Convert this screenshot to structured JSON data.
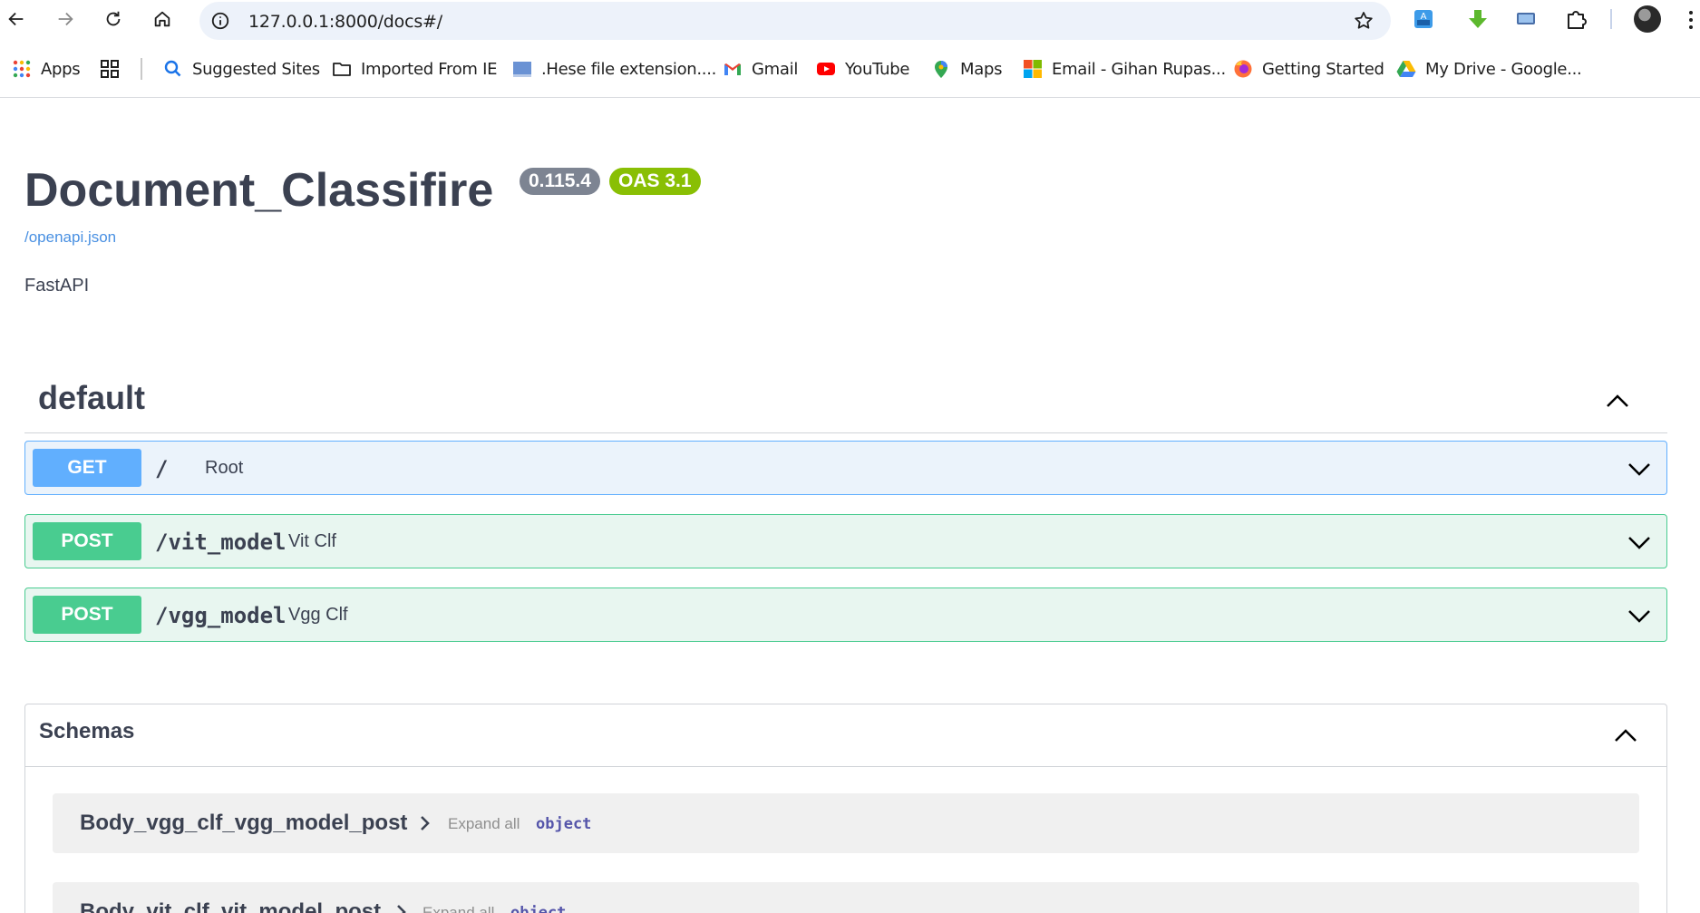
{
  "browser": {
    "url": "127.0.0.1:8000/docs#/",
    "bookmarks": [
      {
        "label": "Apps",
        "icon": "apps-grid-icon"
      },
      {
        "label": "",
        "icon": "tab-groups-icon"
      },
      {
        "label": "Suggested Sites",
        "icon": "search-icon"
      },
      {
        "label": "Imported From IE",
        "icon": "folder-icon"
      },
      {
        "label": ".Hese file extension....",
        "icon": "page-thumbnail-icon"
      },
      {
        "label": "Gmail",
        "icon": "gmail-icon"
      },
      {
        "label": "YouTube",
        "icon": "youtube-icon"
      },
      {
        "label": "Maps",
        "icon": "maps-pin-icon"
      },
      {
        "label": "Email - Gihan Rupas...",
        "icon": "microsoft-icon"
      },
      {
        "label": "Getting Started",
        "icon": "firefox-icon"
      },
      {
        "label": "My Drive - Google...",
        "icon": "google-drive-icon"
      }
    ],
    "colors": {
      "omnibox": "#edf2fa"
    }
  },
  "page": {
    "title": "Document_Classifire",
    "version_badge": "0.115.4",
    "oas_badge": "OAS 3.1",
    "openapi_link": "/openapi.json",
    "description": "FastAPI"
  },
  "tag": {
    "name": "default",
    "operations": [
      {
        "method": "GET",
        "path": "/",
        "summary": "Root"
      },
      {
        "method": "POST",
        "path": "/vit_model",
        "summary": "Vit Clf"
      },
      {
        "method": "POST",
        "path": "/vgg_model",
        "summary": "Vgg Clf"
      }
    ]
  },
  "schemas": {
    "title": "Schemas",
    "models": [
      {
        "name": "Body_vgg_clf_vgg_model_post",
        "expand": "Expand all",
        "type": "object"
      },
      {
        "name": "Body_vit_clf_vit_model_post",
        "expand": "Expand all",
        "type": "object"
      }
    ]
  },
  "colors": {
    "get": "#61affe",
    "post": "#49cc90",
    "version_badge": "#7d8492",
    "oas_badge": "#89bf04",
    "link": "#4990e2"
  }
}
